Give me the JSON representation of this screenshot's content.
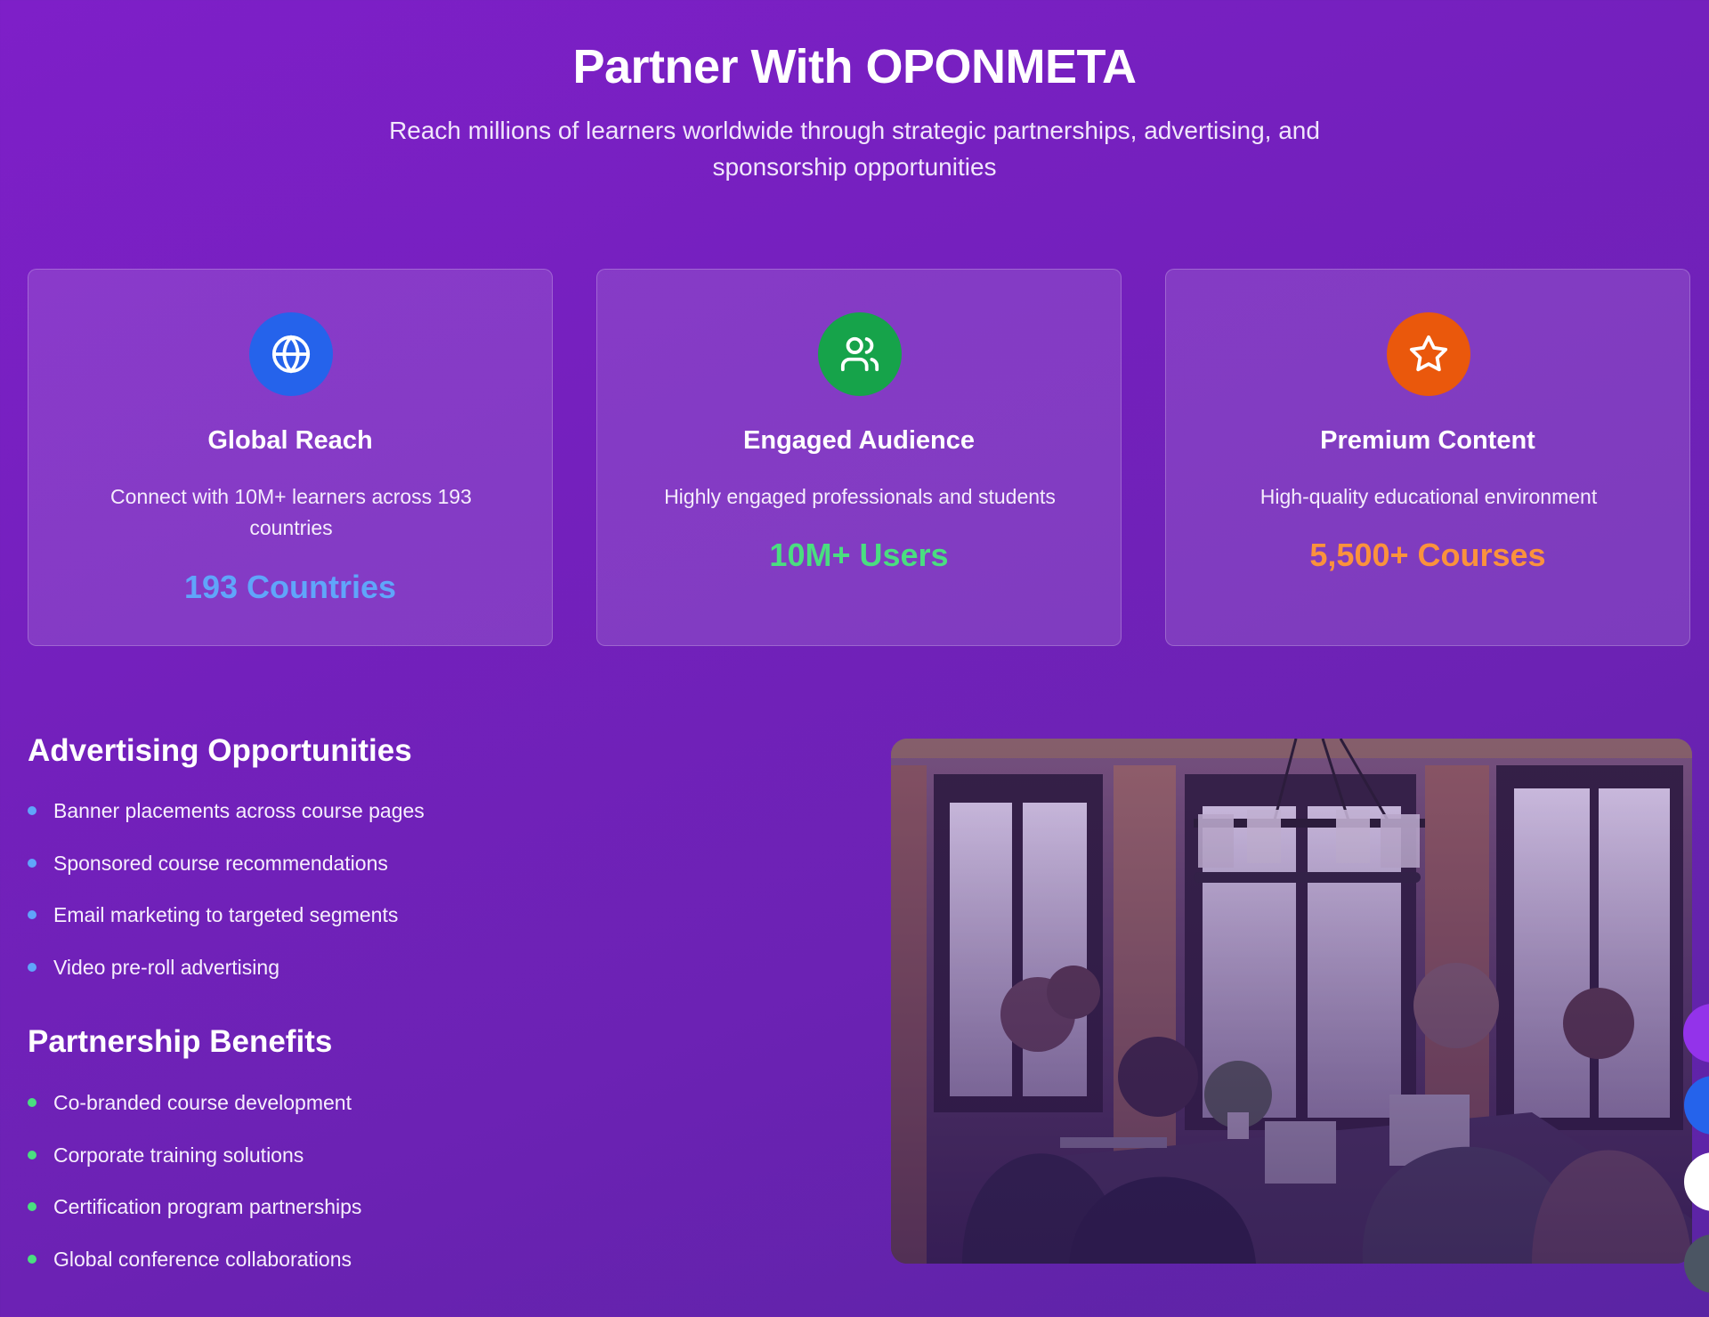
{
  "hero": {
    "title": "Partner With OPONMETA",
    "subtitle": "Reach millions of learners worldwide through strategic partnerships, advertising, and sponsorship opportunities"
  },
  "cards": [
    {
      "icon": "globe-icon",
      "icon_bg": "#2563eb",
      "title": "Global Reach",
      "description": "Connect with 10M+ learners across 193 countries",
      "stat": "193 Countries",
      "stat_color": "#60a5fa"
    },
    {
      "icon": "users-icon",
      "icon_bg": "#16a34a",
      "title": "Engaged Audience",
      "description": "Highly engaged professionals and students",
      "stat": "10M+ Users",
      "stat_color": "#4ade80"
    },
    {
      "icon": "star-icon",
      "icon_bg": "#ea580c",
      "title": "Premium Content",
      "description": "High-quality educational environment",
      "stat": "5,500+ Courses",
      "stat_color": "#fb923c"
    }
  ],
  "advertising": {
    "heading": "Advertising Opportunities",
    "bullet_color": "#60a5fa",
    "items": [
      "Banner placements across course pages",
      "Sponsored course recommendations",
      "Email marketing to targeted segments",
      "Video pre-roll advertising"
    ]
  },
  "partnership": {
    "heading": "Partnership Benefits",
    "bullet_color": "#4ade80",
    "items": [
      "Co-branded course development",
      "Corporate training solutions",
      "Certification program partnerships",
      "Global conference collaborations"
    ]
  },
  "media": {
    "icon": "team-meeting-photo"
  },
  "floating_buttons": [
    {
      "icon": "purple-action-button",
      "color": "#9333ea"
    },
    {
      "icon": "blue-action-button",
      "color": "#2563eb"
    },
    {
      "icon": "white-action-button",
      "color": "#ffffff"
    },
    {
      "icon": "gray-action-button",
      "color": "#4b5563"
    }
  ]
}
